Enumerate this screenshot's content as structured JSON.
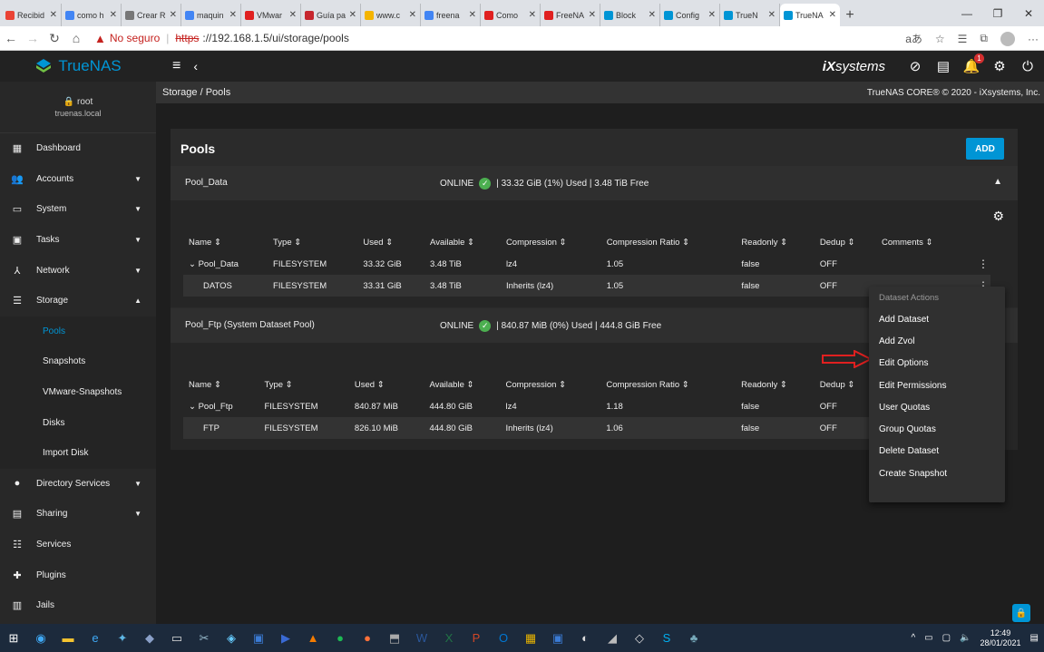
{
  "browser": {
    "tabs": [
      {
        "label": "Recibid",
        "color": "#ea4335"
      },
      {
        "label": "como h",
        "color": "#4285f4"
      },
      {
        "label": "Crear R",
        "color": "#777777"
      },
      {
        "label": "maquin",
        "color": "#4285f4"
      },
      {
        "label": "VMwar",
        "color": "#e02020"
      },
      {
        "label": "Guía pa",
        "color": "#c6262e"
      },
      {
        "label": "www.c",
        "color": "#f4b400"
      },
      {
        "label": "freena",
        "color": "#4285f4"
      },
      {
        "label": "Como",
        "color": "#e02020"
      },
      {
        "label": "FreeNA",
        "color": "#e02020"
      },
      {
        "label": "Block",
        "color": "#0095d5"
      },
      {
        "label": "Config",
        "color": "#0095d5"
      },
      {
        "label": "TrueN",
        "color": "#0095d5"
      },
      {
        "label": "TrueNA",
        "color": "#0095d5",
        "active": true
      }
    ],
    "not_secure": "No seguro",
    "url_scheme": "https",
    "url_rest": "://192.168.1.5/ui/storage/pools"
  },
  "topbar": {
    "logo": "TrueNAS",
    "ix_logo": "systems",
    "notification_count": "1"
  },
  "sidebar": {
    "user": "root",
    "host": "truenas.local",
    "items": [
      {
        "label": "Dashboard",
        "icon": "dashboard-icon",
        "glyph": "▦"
      },
      {
        "label": "Accounts",
        "icon": "accounts-icon",
        "glyph": "👥",
        "caret": "▼"
      },
      {
        "label": "System",
        "icon": "system-icon",
        "glyph": "▭",
        "caret": "▼"
      },
      {
        "label": "Tasks",
        "icon": "tasks-icon",
        "glyph": "▣",
        "caret": "▼"
      },
      {
        "label": "Network",
        "icon": "network-icon",
        "glyph": "⅄",
        "caret": "▼"
      },
      {
        "label": "Storage",
        "icon": "storage-icon",
        "glyph": "☰",
        "caret": "▲"
      }
    ],
    "storage_sub": [
      "Pools",
      "Snapshots",
      "VMware-Snapshots",
      "Disks",
      "Import Disk"
    ],
    "items_after": [
      {
        "label": "Directory Services",
        "icon": "directory-services-icon",
        "glyph": "●",
        "caret": "▼"
      },
      {
        "label": "Sharing",
        "icon": "sharing-icon",
        "glyph": "▤",
        "caret": "▼"
      },
      {
        "label": "Services",
        "icon": "services-icon",
        "glyph": "☷"
      },
      {
        "label": "Plugins",
        "icon": "plugins-icon",
        "glyph": "✚"
      },
      {
        "label": "Jails",
        "icon": "jails-icon",
        "glyph": "▥"
      }
    ]
  },
  "main": {
    "breadcrumb": "Storage / Pools",
    "copyright": "TrueNAS CORE® © 2020 - iXsystems, Inc.",
    "pools_title": "Pools",
    "add_label": "ADD",
    "columns_a": [
      "Name ⇕",
      "Type ⇕",
      "Used ⇕",
      "Available ⇕",
      "Compression ⇕",
      "Compression Ratio ⇕",
      "Readonly ⇕",
      "Dedup ⇕",
      "Comments ⇕"
    ],
    "pools": [
      {
        "name": "Pool_Data",
        "status": "ONLINE",
        "usage": "| 33.32 GiB (1%) Used | 3.48 TiB Free",
        "rows": [
          [
            "⌄ Pool_Data",
            "FILESYSTEM",
            "33.32 GiB",
            "3.48 TiB",
            "lz4",
            "1.05",
            "false",
            "OFF",
            ""
          ],
          [
            "DATOS",
            "FILESYSTEM",
            "33.31 GiB",
            "3.48 TiB",
            "Inherits (lz4)",
            "1.05",
            "false",
            "OFF",
            ""
          ]
        ]
      },
      {
        "name": "Pool_Ftp   (System Dataset Pool)",
        "status": "ONLINE",
        "usage": "| 840.87 MiB (0%) Used | 444.8 GiB Free",
        "rows": [
          [
            "⌄ Pool_Ftp",
            "FILESYSTEM",
            "840.87 MiB",
            "444.80 GiB",
            "lz4",
            "1.18",
            "false",
            "OFF",
            ""
          ],
          [
            "FTP",
            "FILESYSTEM",
            "826.10 MiB",
            "444.80 GiB",
            "Inherits (lz4)",
            "1.06",
            "false",
            "OFF",
            ""
          ]
        ]
      }
    ]
  },
  "context_menu": {
    "title": "Dataset Actions",
    "items": [
      "Add Dataset",
      "Add Zvol",
      "Edit Options",
      "Edit Permissions",
      "User Quotas",
      "Group Quotas",
      "Delete Dataset",
      "Create Snapshot"
    ]
  },
  "taskbar": {
    "time": "12:49",
    "date": "28/01/2021"
  },
  "colors": {
    "accent": "#0095d5",
    "online": "#4caf50",
    "arrow": "#e02020"
  }
}
